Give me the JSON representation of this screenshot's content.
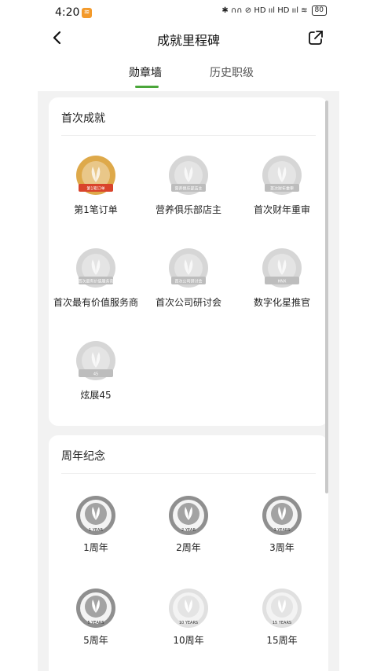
{
  "status_bar": {
    "time": "4:20",
    "app_badge": "≋",
    "icons_text": "✱ ∩∩ ⊘ HD ııl HD ııl ≋",
    "battery": "80"
  },
  "header": {
    "title": "成就里程碑"
  },
  "tabs": {
    "active": "勋章墙",
    "inactive": "历史职级"
  },
  "sections": {
    "first": {
      "title": "首次成就",
      "badges": [
        {
          "label": "第1笔订单",
          "medal_text": "第1笔订单",
          "color": "#d89a2a"
        },
        {
          "label": "营养俱乐部店主",
          "medal_text": "营养俱乐部店主",
          "color": "#cfcfcf"
        },
        {
          "label": "首次财年重审",
          "medal_text": "首次财年重审",
          "color": "#cfcfcf"
        },
        {
          "label": "首次最有价值服务商",
          "medal_text": "首次最有价值服务商",
          "color": "#cfcfcf"
        },
        {
          "label": "首次公司研讨会",
          "medal_text": "首次公司研讨会",
          "color": "#cfcfcf"
        },
        {
          "label": "数字化星推官",
          "medal_text": "HNX",
          "color": "#cfcfcf"
        },
        {
          "label": "炫展45",
          "medal_text": "45",
          "color": "#cfcfcf"
        }
      ]
    },
    "anniversary": {
      "title": "周年纪念",
      "badges": [
        {
          "label": "1周年",
          "medal_text": "1 YEAR",
          "color": "#8f8f8f"
        },
        {
          "label": "2周年",
          "medal_text": "2 YEAR",
          "color": "#8f8f8f"
        },
        {
          "label": "3周年",
          "medal_text": "3 YEARS",
          "color": "#8f8f8f"
        },
        {
          "label": "5周年",
          "medal_text": "5 YEARS",
          "color": "#8f8f8f"
        },
        {
          "label": "10周年",
          "medal_text": "10 YEARS",
          "color": "#e0e0e0"
        },
        {
          "label": "15周年",
          "medal_text": "15 YEARS",
          "color": "#e0e0e0"
        }
      ]
    }
  },
  "colors": {
    "accent": "#4aa63a",
    "gold": "#d89a2a",
    "locked": "#cfcfcf"
  }
}
